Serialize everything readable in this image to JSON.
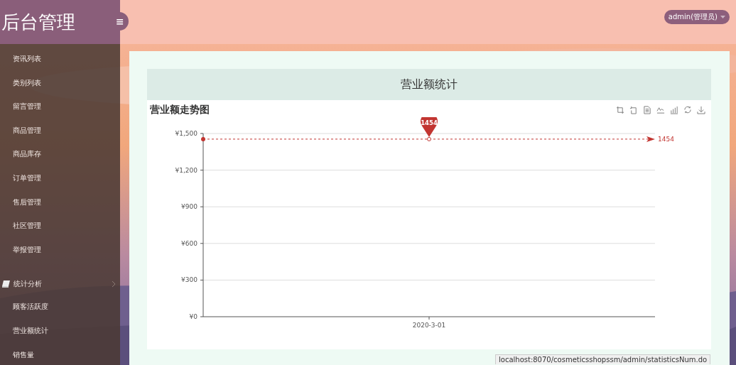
{
  "sidebar": {
    "logo": "后台管理",
    "toggle": "≡",
    "items": [
      {
        "label": "资讯列表"
      },
      {
        "label": "类别列表"
      },
      {
        "label": "留言管理"
      },
      {
        "label": "商品管理"
      },
      {
        "label": "商品库存"
      },
      {
        "label": "订单管理"
      },
      {
        "label": "售后管理"
      },
      {
        "label": "社区管理"
      },
      {
        "label": "举报管理"
      },
      {
        "label": "统计分析",
        "children": [
          {
            "label": "顾客活跃度"
          },
          {
            "label": "营业额统计"
          },
          {
            "label": "销售量"
          }
        ]
      }
    ]
  },
  "header": {
    "user": "admin(管理员)"
  },
  "panel": {
    "title": "营业额统计",
    "chart_data": {
      "type": "line",
      "title": "营业额走势图",
      "categories": [
        "2020-3-01"
      ],
      "series": [
        {
          "color": "#c23531",
          "marker": "circle",
          "values": [
            1454
          ]
        }
      ],
      "grid": true,
      "ylim": [
        0,
        1500
      ],
      "yticks": [
        {
          "value": 0,
          "label": "¥0"
        },
        {
          "value": 300,
          "label": "¥300"
        },
        {
          "value": 600,
          "label": "¥600"
        },
        {
          "value": 900,
          "label": "¥900"
        },
        {
          "value": 1200,
          "label": "¥1,200"
        },
        {
          "value": 1500,
          "label": "¥1,500"
        }
      ],
      "annotations": [
        {
          "text": "1454",
          "x": "2020-3-01",
          "y": 1454
        }
      ],
      "ref_lines": [
        {
          "axis": "y",
          "value": 1454,
          "label": "1454"
        }
      ]
    }
  },
  "status_bar": {
    "url": "localhost:8070/cosmeticsshopssm/admin/statisticsNum.do"
  }
}
